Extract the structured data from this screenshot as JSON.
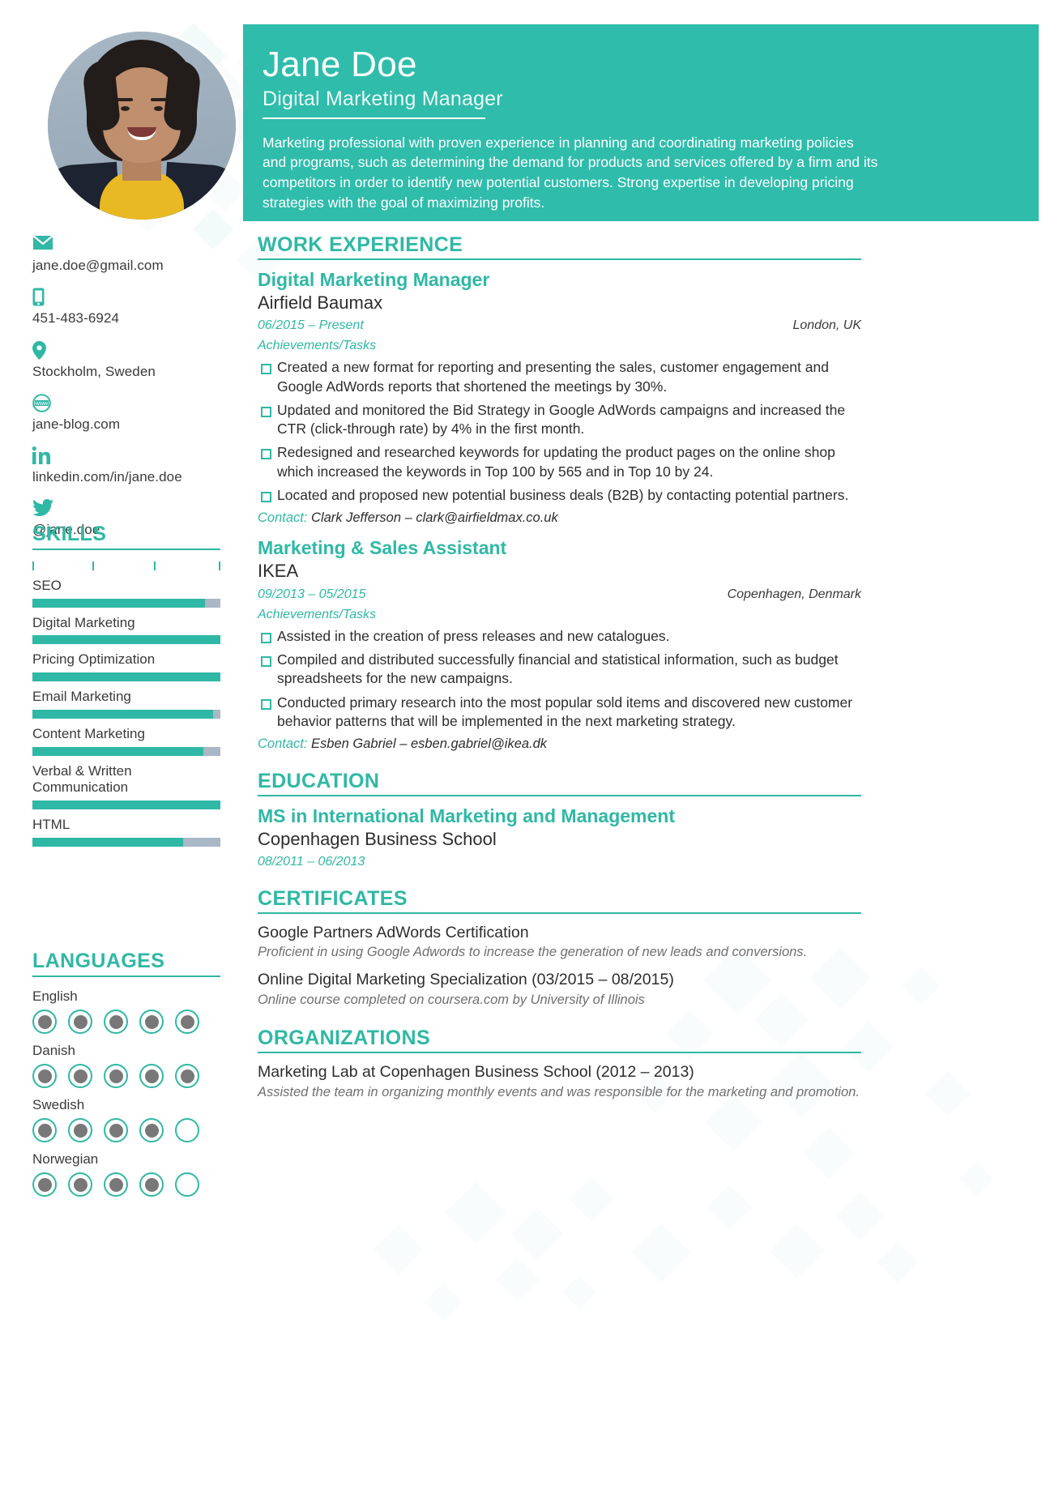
{
  "theme": {
    "accent": "#2fb8a5",
    "banner_bg": "#2fbcab",
    "bar_track": "#a9b7c6",
    "dot_fill": "#787878"
  },
  "header": {
    "name": "Jane Doe",
    "title": "Digital Marketing Manager",
    "summary": "Marketing professional with proven experience in planning and coordinating marketing policies and programs, such as determining the demand for products and services offered by a firm and its competitors in order to identify new potential customers. Strong expertise in developing pricing strategies with the goal of maximizing profits."
  },
  "contact": [
    {
      "icon": "envelope-icon",
      "text": "jane.doe@gmail.com"
    },
    {
      "icon": "mobile-phone-icon",
      "text": "451-483-6924"
    },
    {
      "icon": "location-pin-icon",
      "text": "Stockholm, Sweden"
    },
    {
      "icon": "website-www-icon",
      "text": "jane-blog.com"
    },
    {
      "icon": "linkedin-icon",
      "text": "linkedin.com/in/jane.doe"
    },
    {
      "icon": "twitter-icon",
      "text": "@jane.doe"
    }
  ],
  "skills": {
    "heading": "SKILLS",
    "items": [
      {
        "label": "SEO",
        "value": 92
      },
      {
        "label": "Digital Marketing",
        "value": 100
      },
      {
        "label": "Pricing Optimization",
        "value": 100
      },
      {
        "label": "Email Marketing",
        "value": 96
      },
      {
        "label": "Content Marketing",
        "value": 91
      },
      {
        "label": "Verbal & Written Communication",
        "value": 100
      },
      {
        "label": "HTML",
        "value": 80
      }
    ]
  },
  "languages": {
    "heading": "LANGUAGES",
    "items": [
      {
        "label": "English",
        "level": 5,
        "max": 5
      },
      {
        "label": "Danish",
        "level": 5,
        "max": 5
      },
      {
        "label": "Swedish",
        "level": 4,
        "max": 5
      },
      {
        "label": "Norwegian",
        "level": 4,
        "max": 5
      }
    ]
  },
  "work": {
    "heading": "WORK EXPERIENCE",
    "jobs": [
      {
        "title": "Digital Marketing Manager",
        "organization": "Airfield Baumax",
        "date": "06/2015 – Present",
        "location": "London, UK",
        "subheading": "Achievements/Tasks",
        "tasks": [
          "Created a new format for reporting and presenting the sales, customer engagement and Google AdWords reports that shortened the meetings by 30%.",
          "Updated and monitored the Bid Strategy in Google AdWords campaigns and increased the CTR (click-through rate) by 4% in the first month.",
          "Redesigned and researched keywords for updating the product pages on the online shop which increased the keywords in Top 100 by 565 and in Top 10 by 24.",
          "Located and proposed new potential business deals (B2B) by contacting potential partners."
        ],
        "contact_label": "Contact:",
        "contact_value": "Clark Jefferson – clark@airfieldmax.co.uk"
      },
      {
        "title": "Marketing & Sales Assistant",
        "organization": "IKEA",
        "date": "09/2013 – 05/2015",
        "location": "Copenhagen, Denmark",
        "subheading": "Achievements/Tasks",
        "tasks": [
          "Assisted in the creation of press releases and new catalogues.",
          "Compiled and distributed successfully financial and statistical information, such as budget spreadsheets for the new campaigns.",
          "Conducted primary research into the most popular sold items and discovered new customer behavior patterns that will be implemented in the next marketing strategy."
        ],
        "contact_label": "Contact:",
        "contact_value": "Esben Gabriel – esben.gabriel@ikea.dk"
      }
    ]
  },
  "education": {
    "heading": "EDUCATION",
    "items": [
      {
        "degree": "MS in International Marketing and Management",
        "school": "Copenhagen Business School",
        "date": "08/2011 – 06/2013"
      }
    ]
  },
  "certificates": {
    "heading": "CERTIFICATES",
    "items": [
      {
        "title": "Google Partners AdWords Certification",
        "description": "Proficient in using Google Adwords to increase the generation of new leads and conversions."
      },
      {
        "title": "Online Digital Marketing Specialization (03/2015 – 08/2015)",
        "description": "Online course completed on coursera.com by University of Illinois"
      }
    ]
  },
  "organizations": {
    "heading": "ORGANIZATIONS",
    "items": [
      {
        "title": "Marketing Lab at Copenhagen Business School (2012 – 2013)",
        "description": "Assisted the team in organizing monthly events and was responsible for the marketing and promotion."
      }
    ]
  }
}
